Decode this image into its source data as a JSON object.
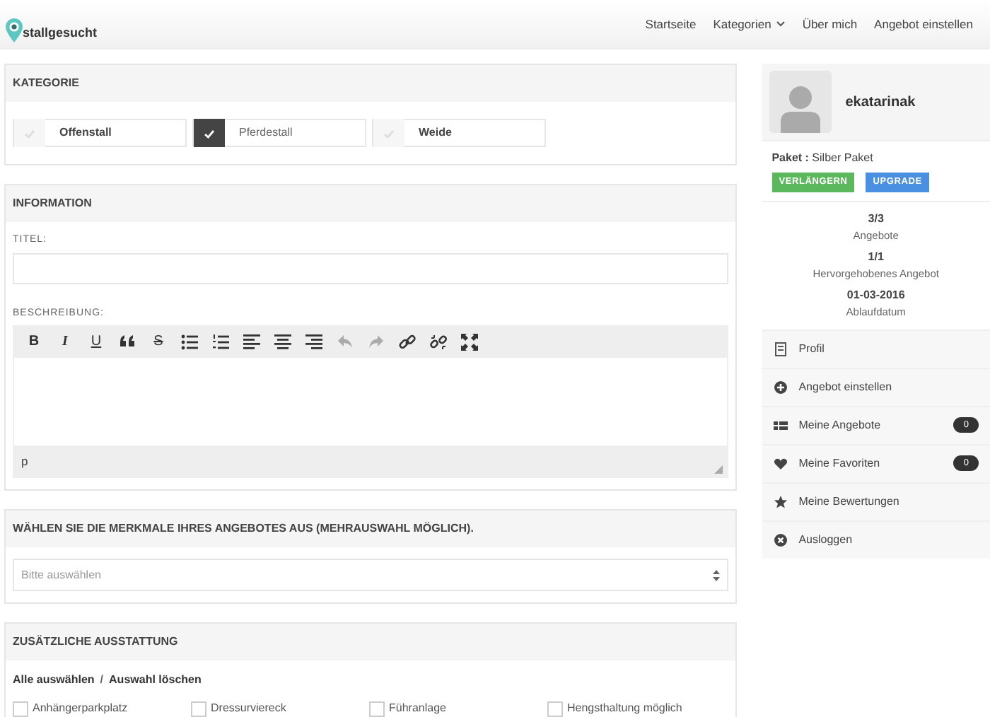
{
  "brand": "stallgesucht",
  "nav": [
    {
      "label": "Startseite",
      "dropdown": false
    },
    {
      "label": "Kategorien",
      "dropdown": true
    },
    {
      "label": "Über mich",
      "dropdown": false
    },
    {
      "label": "Angebot einstellen",
      "dropdown": false
    }
  ],
  "kategorie": {
    "title": "KATEGORIE",
    "options": [
      {
        "label": "Offenstall",
        "checked": false
      },
      {
        "label": "Pferdestall",
        "checked": true
      },
      {
        "label": "Weide",
        "checked": false
      }
    ]
  },
  "information": {
    "title": "INFORMATION",
    "title_label": "TITEL:",
    "description_label": "BESCHREIBUNG:",
    "toolbar": [
      {
        "kind": "bold",
        "glyph": "B",
        "disabled": false
      },
      {
        "kind": "italic",
        "glyph": "I",
        "disabled": false
      },
      {
        "kind": "underline",
        "glyph": "U",
        "disabled": false
      },
      {
        "kind": "quote",
        "disabled": false
      },
      {
        "kind": "strike",
        "glyph": "S",
        "disabled": false
      },
      {
        "kind": "bullets",
        "disabled": false
      },
      {
        "kind": "numbers",
        "disabled": false
      },
      {
        "kind": "align-left",
        "disabled": false
      },
      {
        "kind": "align-center",
        "disabled": false
      },
      {
        "kind": "align-right",
        "disabled": false
      },
      {
        "kind": "undo",
        "disabled": true
      },
      {
        "kind": "redo",
        "disabled": true
      },
      {
        "kind": "link",
        "disabled": false
      },
      {
        "kind": "unlink",
        "disabled": false
      },
      {
        "kind": "fullscreen",
        "disabled": false
      }
    ],
    "status_path": "p"
  },
  "merkmale": {
    "title": "WÄHLEN SIE DIE MERKMALE IHRES ANGEBOTES AUS (MEHRAUSWAHL MÖGLICH).",
    "placeholder": "Bitte auswählen"
  },
  "ausstattung": {
    "title": "ZUSÄTZLICHE AUSSTATTUNG",
    "select_all": "Alle auswählen",
    "separator": "/",
    "clear": "Auswahl löschen",
    "options": [
      {
        "label": "Anhängerparkplatz",
        "checked": false
      },
      {
        "label": "Dressurviereck",
        "checked": false
      },
      {
        "label": "Führanlage",
        "checked": false
      },
      {
        "label": "Hengsthaltung möglich",
        "checked": false
      }
    ]
  },
  "profile": {
    "username": "ekatarinak",
    "package_label": "Paket :",
    "package": "Silber Paket",
    "buttons": [
      {
        "label": "VERLÄNGERN",
        "kind": "success"
      },
      {
        "label": "UPGRADE",
        "kind": "primary"
      }
    ],
    "stats": [
      {
        "value": "3/3",
        "label": "Angebote"
      },
      {
        "value": "1/1",
        "label": "Hervorgehobenes Angebot"
      },
      {
        "value": "01-03-2016",
        "label": "Ablaufdatum"
      }
    ],
    "menu": [
      {
        "kind": "profile",
        "label": "Profil"
      },
      {
        "kind": "add",
        "label": "Angebot einstellen"
      },
      {
        "kind": "list",
        "label": "Meine Angebote",
        "badge": "0"
      },
      {
        "kind": "heart",
        "label": "Meine Favoriten",
        "badge": "0"
      },
      {
        "kind": "star",
        "label": "Meine Bewertungen"
      },
      {
        "kind": "logout",
        "label": "Ausloggen"
      }
    ]
  }
}
